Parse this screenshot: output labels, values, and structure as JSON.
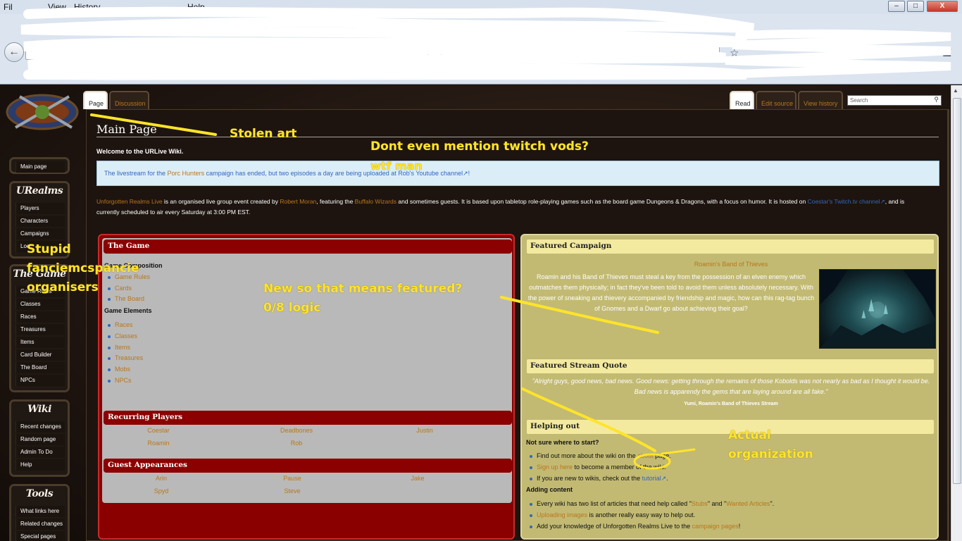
{
  "browser": {
    "menu": [
      "Fil",
      "View",
      "History",
      "Help"
    ],
    "search_placeholder": "Search",
    "window_buttons": {
      "minimize": "–",
      "maximize": "□",
      "close": "X"
    }
  },
  "wiki": {
    "tabs_left": [
      "Page",
      "Discussion"
    ],
    "tabs_right": [
      "Read",
      "Edit source",
      "View history"
    ],
    "search_placeholder": "Search"
  },
  "sidebar": {
    "main_page": "Main page",
    "sections": [
      {
        "title": "URealms",
        "items": [
          "Players",
          "Characters",
          "Campaigns",
          "Loc"
        ]
      },
      {
        "title": "The Game",
        "items": [
          "Game Rules",
          "Classes",
          "Races",
          "Treasures",
          "Items",
          "Card Builder",
          "The Board",
          "NPCs"
        ]
      },
      {
        "title": "Wiki",
        "items": [
          "Recent changes",
          "Random page",
          "Admin To Do",
          "Help"
        ]
      },
      {
        "title": "Tools",
        "items": [
          "What links here",
          "Related changes",
          "Special pages"
        ]
      }
    ]
  },
  "content": {
    "title": "Main Page",
    "welcome": "Welcome to the URLive Wiki.",
    "notice": {
      "pre": "The livestream for the ",
      "link1": "Porc Hunters",
      "mid": " campaign has ended, but two episodes a day are being uploaded at ",
      "link2": "Rob's Youtube channel",
      "post": "!"
    },
    "intro": {
      "link1": "Unforgotten Realms Live",
      "t1": " is an organised live group event created by ",
      "link2": "Robert Moran",
      "t2": ", featuring the ",
      "link3": "Buffalo Wizards",
      "t3": " and sometimes guests. It is based upon tabletop role-playing games such as the board game Dungeons & Dragons, with a focus on humor. It is hosted on ",
      "link4": "Coestar's Twitch.tv channel",
      "t4": ", and is currently scheduled to air every Saturday at 3:00 PM EST."
    }
  },
  "game_panel": {
    "heading": "The Game",
    "composition_label": "Game Composition",
    "composition": [
      "Game Rules",
      "Cards",
      "The Board"
    ],
    "elements_label": "Game Elements",
    "elements": [
      "Races",
      "Classes",
      "Items",
      "Treasures",
      "Mobs",
      "NPCs"
    ],
    "recurring_heading": "Recurring Players",
    "recurring": [
      "Coestar",
      "Deadbones",
      "Justin",
      "Roamin",
      "Rob"
    ],
    "guest_heading": "Guest Appearances",
    "guests": [
      "Arin",
      "Pause",
      "Jake",
      "Spyd",
      "Steve"
    ]
  },
  "featured": {
    "campaign_heading": "Featured Campaign",
    "campaign_title": "Roamin's Band of Thieves",
    "campaign_text": "Roamin and his Band of Thieves must steal a key from the possession of an elven enemy which outmatches them physically; in fact they've been told to avoid them unless absolutely necessary. With the power of sneaking and thievery accompanied by friendship and magic, how can this rag-tag bunch of Gnomes and a Dwarf go about achieving their goal?",
    "quote_heading": "Featured Stream Quote",
    "quote": "\"Alright guys, good news, bad news. Good news: getting through the remains of those Kobolds was not nearly as bad as I thought it would be. Bad news is apparendy the gems that are laying around are all fake.\"",
    "quote_attr": "Yumi, Roamin's Band of Thieves Stream",
    "help_heading": "Helping out",
    "start_label": "Not sure where to start?",
    "start_items": [
      {
        "pre": "Find out more about the wiki on the ",
        "link": "about",
        "post": " page."
      },
      {
        "pre": "",
        "link": "Sign up here",
        "post": " to become a member of the wiki."
      },
      {
        "pre": "If you are new to wikis, check out the ",
        "link": "tutorial",
        "post": "."
      }
    ],
    "adding_label": "Adding content",
    "adding_items": [
      {
        "pre": "Every wiki has two list of articles that need help called \"",
        "link": "Stubs",
        "mid": "\" and \"",
        "link2": "Wanted Articles",
        "post": "\"."
      },
      {
        "pre": "",
        "link": "Uploading images",
        "post": " is another really easy way to help out."
      },
      {
        "pre": "Add your knowledge of Unforgotten Realms Live to the ",
        "link": "campaign pages",
        "post": "!"
      }
    ]
  },
  "annotations": {
    "stolen_art": "Stolen art",
    "twitch_1": "Dont even mention twitch vods?",
    "twitch_2": "wtf man",
    "stupid_1": "Stupid",
    "stupid_2": "fanciemcspancie",
    "stupid_3": "organisers",
    "featured_1": "New so that means featured?",
    "featured_2": "0/8 logic",
    "actual_1": "Actual",
    "actual_2": "organization",
    "color": "#ffe42a"
  }
}
